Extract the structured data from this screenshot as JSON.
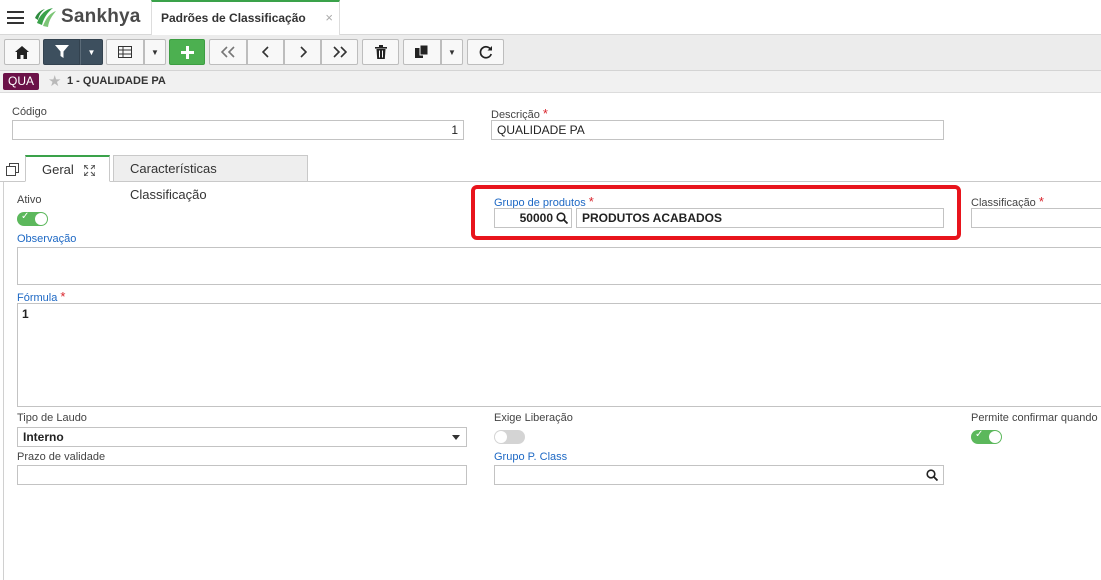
{
  "header": {
    "brand": "Sankhya",
    "tab_title": "Padrões de Classificação",
    "tab_close": "×"
  },
  "breadcrumb": {
    "badge": "QUA",
    "title": "1 - QUALIDADE PA"
  },
  "form": {
    "codigo_label": "Código",
    "codigo_value": "1",
    "descricao_label": "Descrição",
    "descricao_value": "QUALIDADE PA",
    "required_mark": "*"
  },
  "tabs": [
    {
      "label": "Geral"
    },
    {
      "label": "Características Classificação"
    }
  ],
  "geral": {
    "ativo_label": "Ativo",
    "ativo_on": true,
    "grupo_produtos_label": "Grupo de produtos",
    "grupo_produtos_code": "50000",
    "grupo_produtos_name": "PRODUTOS ACABADOS",
    "classificacao_label": "Classificação",
    "observacao_label": "Observação",
    "formula_label": "Fórmula",
    "formula_value": "1",
    "tipo_laudo_label": "Tipo de Laudo",
    "tipo_laudo_value": "Interno",
    "exige_liberacao_label": "Exige Liberação",
    "exige_liberacao_on": false,
    "permite_confirmar_label": "Permite confirmar quando l",
    "permite_confirmar_on": true,
    "prazo_validade_label": "Prazo de validade",
    "grupo_p_class_label": "Grupo P. Class"
  },
  "colors": {
    "accent_green": "#3aa24a",
    "toolbar_dark": "#3d4f5e",
    "badge": "#6b1148",
    "link_blue": "#1d68c4",
    "highlight_red": "#e8141c"
  }
}
